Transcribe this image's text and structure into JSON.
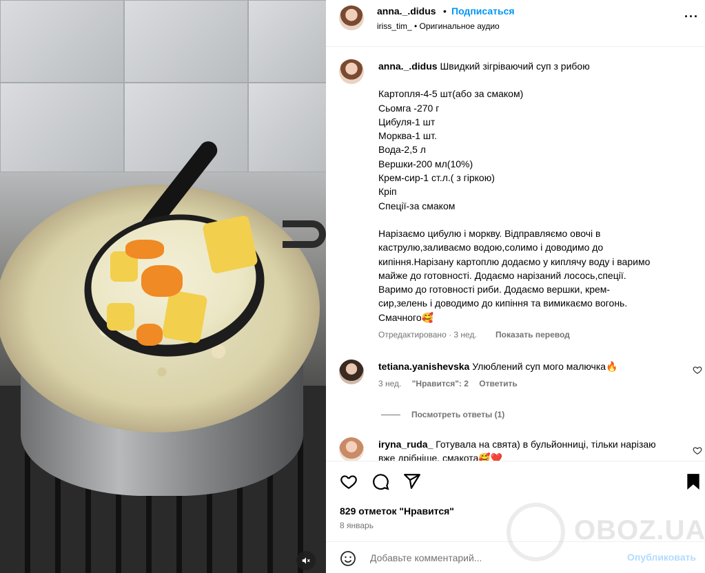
{
  "post": {
    "author": "anna._.didus",
    "follow_label": "Подписаться",
    "audio_line": "iriss_tim_ • Оригинальное аудио",
    "separator": "•"
  },
  "caption": {
    "author": "anna._.didus",
    "title": "Швидкий зігріваючий суп з рибою",
    "ingredients": [
      "Картопля-4-5 шт(або за смаком)",
      "Сьомга -270 г",
      "Цибуля-1 шт",
      "Морква-1 шт.",
      "Вода-2,5 л",
      "Вершки-200 мл(10%)",
      "Крем-сир-1 ст.л.( з гіркою)",
      "Кріп",
      "Спеції-за смаком"
    ],
    "method_lines": [
      "Нарізаємо цибулю і моркву. Відправляємо овочі в",
      "каструлю,заливаємо водою,солимо і доводимо до",
      "кипіння.Нарізану картоплю додаємо у киплячу воду і варимо",
      "майже до готовності. Додаємо нарізаний лосось,спеції.",
      "Варимо до готовності риби. Додаємо вершки, крем-",
      "сир,зелень і доводимо до кипіння та вимикаємо вогонь.",
      "Смачного🥰"
    ],
    "meta": "Отредактировано · 3 нед.",
    "translate": "Показать перевод"
  },
  "comments": [
    {
      "user": "tetiana.yanishevska",
      "text": "Улюблений суп мого малючка🔥",
      "age": "3 нед.",
      "likes": "\"Нравится\": 2",
      "reply": "Ответить"
    },
    {
      "user": "iryna_ruda_",
      "text": "Готувала на свята) в бульйонниці, тільки нарізаю вже дрібніше, смакота🥰❤️"
    }
  ],
  "view_replies": "Посмотреть ответы (1)",
  "likes_count": "829 отметок \"Нравится\"",
  "post_date": "8 январь",
  "comment_box": {
    "placeholder": "Добавьте комментарий...",
    "publish": "Опубликовать"
  },
  "watermark": "OBOZ.UA",
  "icons": {
    "like": "heart-icon",
    "comment": "comment-icon",
    "share": "share-icon",
    "save": "bookmark-icon",
    "more": "more-icon",
    "mute": "mute-icon",
    "emoji": "emoji-icon"
  },
  "colors": {
    "link": "#0095f6",
    "secondary": "#737373",
    "publish_disabled": "#b3dbff"
  }
}
